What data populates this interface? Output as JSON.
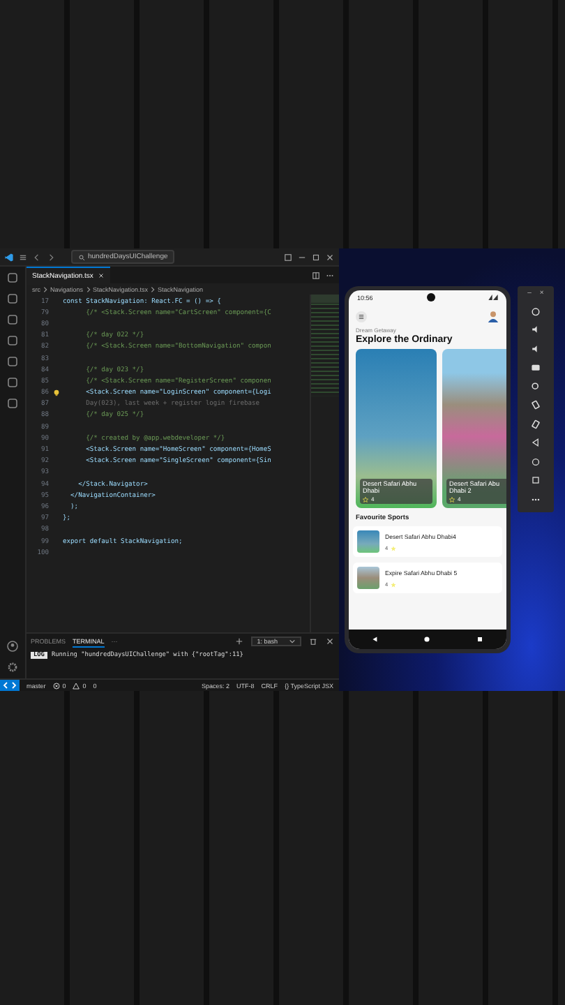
{
  "editor": {
    "search": "hundredDaysUIChallenge",
    "tabs": [
      {
        "label": "StackNavigation.tsx",
        "selected": true
      }
    ],
    "breadcrumb": [
      "src",
      "Navigations",
      "StackNavigation.tsx",
      "StackNavigation"
    ],
    "lines": [
      {
        "num": "17",
        "text": "const StackNavigation: React.FC = () => {",
        "kind": "code",
        "lightbulb": false
      },
      {
        "num": "79",
        "text": "      {/* <Stack.Screen name=\"CartScreen\" component={C",
        "kind": "comment",
        "lightbulb": false
      },
      {
        "num": "80",
        "lightbulb": false
      },
      {
        "num": "81",
        "text": "      {/* day 022 */}",
        "kind": "comment",
        "lightbulb": false
      },
      {
        "num": "82",
        "text": "      {/* <Stack.Screen name=\"BottomNavigation\" compon",
        "kind": "comment",
        "lightbulb": false
      },
      {
        "num": "83",
        "lightbulb": false
      },
      {
        "num": "84",
        "text": "      {/* day 023 */}",
        "kind": "comment",
        "lightbulb": false
      },
      {
        "num": "85",
        "text": "      {/* <Stack.Screen name=\"RegisterScreen\" componen",
        "kind": "comment",
        "lightbulb": false
      },
      {
        "num": "86",
        "text": "      <Stack.Screen name=\"LoginScreen\" component={Logi",
        "kind": "code",
        "lightbulb": true
      },
      {
        "num": "87",
        "text": "      Day(023), last week + register login firebase",
        "kind": "ghost",
        "lightbulb": false
      },
      {
        "num": "88",
        "text": "      {/* day 025 */}",
        "kind": "comment",
        "lightbulb": false
      },
      {
        "num": "89",
        "lightbulb": false
      },
      {
        "num": "90",
        "text": "      {/* created by @app.webdeveloper */}",
        "kind": "comment",
        "lightbulb": false
      },
      {
        "num": "91",
        "text": "      <Stack.Screen name=\"HomeScreen\" component={HomeS",
        "kind": "code",
        "lightbulb": false
      },
      {
        "num": "92",
        "text": "      <Stack.Screen name=\"SingleScreen\" component={Sin",
        "kind": "code",
        "lightbulb": false
      },
      {
        "num": "93",
        "lightbulb": false
      },
      {
        "num": "94",
        "text": "    </Stack.Navigator>",
        "kind": "code",
        "lightbulb": false
      },
      {
        "num": "95",
        "text": "  </NavigationContainer>",
        "kind": "code",
        "lightbulb": false
      },
      {
        "num": "96",
        "text": "  );",
        "kind": "code",
        "lightbulb": false
      },
      {
        "num": "97",
        "text": "};",
        "kind": "code",
        "lightbulb": false
      },
      {
        "num": "98",
        "lightbulb": false
      },
      {
        "num": "99",
        "text": "export default StackNavigation;",
        "kind": "code",
        "lightbulb": false
      },
      {
        "num": "100",
        "lightbulb": false
      }
    ]
  },
  "panel": {
    "tabs": [
      {
        "label": "PROBLEMS",
        "selected": false
      },
      {
        "label": "TERMINAL",
        "selected": true
      }
    ],
    "more": "···",
    "shell": "1: bash",
    "log_badge": "LOG",
    "log": "Running \"hundredDaysUIChallenge\" with {\"rootTag\":11}"
  },
  "status_bar": {
    "branch": "master",
    "errors": "0",
    "warnings": "0",
    "ports": "0",
    "items": [
      "Spaces: 2",
      "UTF-8",
      "CRLF",
      "{} TypeScript JSX"
    ]
  },
  "phone": {
    "time": "10:56",
    "subtitle": "Dream Getaway",
    "title": "Explore the Ordinary",
    "cards": [
      {
        "name": "Desert Safari Abhu Dhabi",
        "rating": "4",
        "kind": "city"
      },
      {
        "name": "Desert Safari Abu Dhabi 2",
        "rating": "4",
        "kind": "park"
      }
    ],
    "section": "Favourite Sports",
    "favourites": [
      {
        "name": "Desert Safari Abhu Dhabi4",
        "rating": "4",
        "kind": "city"
      },
      {
        "name": "Expire Safari Abhu Dhabi 5",
        "rating": "4",
        "kind": "park"
      }
    ]
  },
  "emulator_toolbar": {
    "minimize": "–",
    "close": "×"
  }
}
